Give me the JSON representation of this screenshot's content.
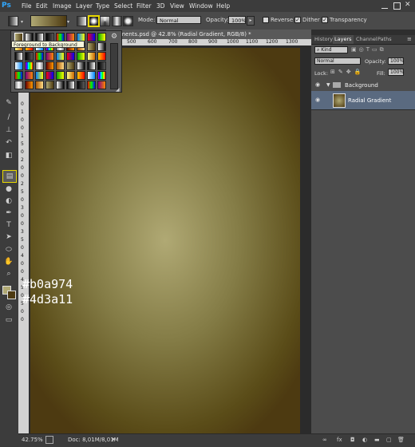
{
  "app": {
    "logo": "Ps"
  },
  "menu": [
    "File",
    "Edit",
    "Image",
    "Layer",
    "Type",
    "Select",
    "Filter",
    "3D",
    "View",
    "Window",
    "Help"
  ],
  "options": {
    "mode_label": "Mode:",
    "mode_value": "Normal",
    "opacity_label": "Opacity:",
    "opacity_value": "100%",
    "reverse_label": "Reverse",
    "dither_label": "Dither",
    "transparency_label": "Transparency",
    "reverse_checked": false,
    "dither_checked": true,
    "transparency_checked": true
  },
  "document": {
    "tab_title": "Segments.psd @ 42.8% (Radial Gradient, RGB/8) *",
    "ruler_top": [
      "500",
      "600",
      "700",
      "800",
      "900",
      "1000",
      "1100",
      "1200",
      "1300"
    ],
    "ruler_left": [
      "0",
      "1",
      "0",
      "0",
      "1",
      "5",
      "0",
      "2",
      "0",
      "0",
      "2",
      "5",
      "0",
      "3",
      "0",
      "0",
      "3",
      "5",
      "0",
      "4",
      "0",
      "0",
      "4",
      "5",
      "0",
      "5",
      "0",
      "0"
    ],
    "gradient_center": "#b0a974",
    "gradient_edge": "#4d3a11",
    "overlay_line1": "#b0a974",
    "overlay_line2": "#4d3a11"
  },
  "gradient_picker": {
    "tooltip": "Foreground to Background",
    "menu_icon": "gear-icon"
  },
  "status": {
    "zoom": "42.75%",
    "doc_info": "Doc: 8,01M/8,01M"
  },
  "panels": {
    "tabs": [
      "History",
      "Layers",
      "Channel",
      "Paths"
    ],
    "active_tab": "Layers",
    "kind_label": "Kind",
    "blend_mode": "Normal",
    "opacity_label": "Opacity:",
    "opacity_value": "100%",
    "lock_label": "Lock:",
    "fill_label": "Fill:",
    "fill_value": "100%",
    "layers": [
      {
        "name": "Background",
        "type": "group"
      },
      {
        "name": "Radial Gradient",
        "type": "layer"
      }
    ]
  }
}
